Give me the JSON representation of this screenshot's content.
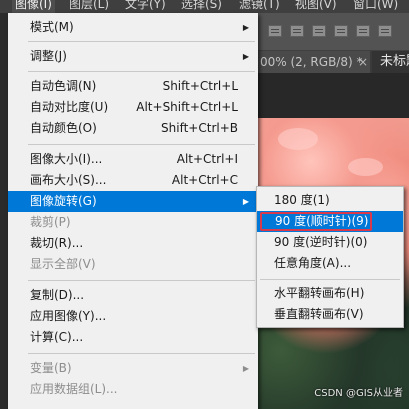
{
  "menubar": {
    "items": [
      {
        "label": "图像(I)",
        "active": true
      },
      {
        "label": "图层(L)"
      },
      {
        "label": "文字(Y)"
      },
      {
        "label": "选择(S)"
      },
      {
        "label": "滤镜(T)"
      },
      {
        "label": "视图(V)"
      },
      {
        "label": "窗口(W)"
      }
    ]
  },
  "document_tabs": {
    "tab1_title": "00% (2, RGB/8) *",
    "tab1_close": "×",
    "tab2_title": "未标题"
  },
  "image_menu": {
    "mode": "模式(M)",
    "adjustments": "调整(J)",
    "auto_tone": "自动色调(N)",
    "auto_tone_shortcut": "Shift+Ctrl+L",
    "auto_contrast": "自动对比度(U)",
    "auto_contrast_shortcut": "Alt+Shift+Ctrl+L",
    "auto_color": "自动颜色(O)",
    "auto_color_shortcut": "Shift+Ctrl+B",
    "image_size": "图像大小(I)...",
    "image_size_shortcut": "Alt+Ctrl+I",
    "canvas_size": "画布大小(S)...",
    "canvas_size_shortcut": "Alt+Ctrl+C",
    "image_rotation": "图像旋转(G)",
    "crop": "裁剪(P)",
    "trim": "裁切(R)...",
    "reveal_all": "显示全部(V)",
    "duplicate": "复制(D)...",
    "apply_image": "应用图像(Y)...",
    "calculations": "计算(C)...",
    "variables": "变量(B)",
    "apply_data_set": "应用数据组(L)..."
  },
  "rotation_submenu": {
    "rotate_180": "180 度(1)",
    "rotate_90_cw": "90 度(顺时针)(9)",
    "rotate_90_ccw": "90 度(逆时针)(0)",
    "arbitrary": "任意角度(A)...",
    "flip_horizontal": "水平翻转画布(H)",
    "flip_vertical": "垂直翻转画布(V)"
  },
  "watermark": "CSDN @GIS从业者"
}
